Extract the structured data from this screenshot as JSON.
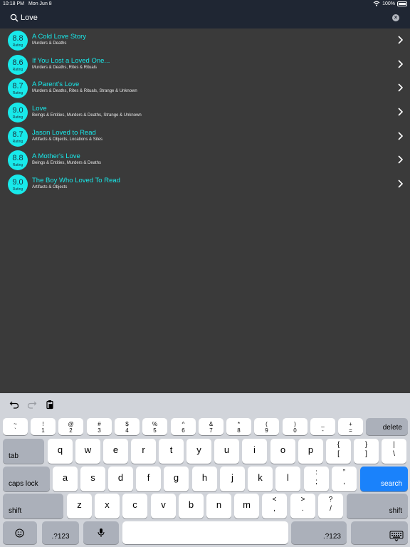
{
  "status": {
    "time": "10:18 PM",
    "date": "Mon Jun 8",
    "battery": "100%"
  },
  "search": {
    "query": "Love"
  },
  "rating_label": "Rating",
  "results": [
    {
      "score": "8.8",
      "title": "A Cold Love Story",
      "categories": "Murders & Deaths"
    },
    {
      "score": "8.6",
      "title": "If You Lost a Loved One...",
      "categories": "Murders & Deaths, Rites & Rituals"
    },
    {
      "score": "8.7",
      "title": "A Parent's Love",
      "categories": "Murders & Deaths, Rites & Rituals, Strange & Unknown"
    },
    {
      "score": "9.0",
      "title": "Love",
      "categories": "Beings & Entities, Murders & Deaths, Strange & Unknown"
    },
    {
      "score": "8.7",
      "title": "Jason Loved to Read",
      "categories": "Artifacts & Objects, Locations & Sites"
    },
    {
      "score": "8.8",
      "title": "A Mother's Love",
      "categories": "Beings & Entities, Murders & Deaths"
    },
    {
      "score": "9.0",
      "title": "The Boy Who Loved To Read",
      "categories": "Artifacts & Objects"
    }
  ],
  "keyboard": {
    "numrow": [
      [
        "~",
        "`"
      ],
      [
        "!",
        "1"
      ],
      [
        "@",
        "2"
      ],
      [
        "#",
        "3"
      ],
      [
        "$",
        "4"
      ],
      [
        "%",
        "5"
      ],
      [
        "^",
        "6"
      ],
      [
        "&",
        "7"
      ],
      [
        "*",
        "8"
      ],
      [
        "(",
        "9"
      ],
      [
        ")",
        "0"
      ],
      [
        "_",
        "-"
      ],
      [
        "+",
        "="
      ]
    ],
    "delete": "delete",
    "tab": "tab",
    "row1": [
      "q",
      "w",
      "e",
      "r",
      "t",
      "y",
      "u",
      "i",
      "o",
      "p"
    ],
    "row1_sym": [
      [
        "{",
        "["
      ],
      [
        "}",
        "]"
      ],
      [
        "|",
        "\\"
      ]
    ],
    "caps": "caps lock",
    "row2": [
      "a",
      "s",
      "d",
      "f",
      "g",
      "h",
      "j",
      "k",
      "l"
    ],
    "row2_sym": [
      [
        ":",
        ";"
      ],
      [
        "”",
        ","
      ]
    ],
    "search": "search",
    "shift": "shift",
    "row3": [
      "z",
      "x",
      "c",
      "v",
      "b",
      "n",
      "m"
    ],
    "row3_sym": [
      [
        "<",
        ","
      ],
      [
        ">",
        "."
      ],
      [
        "?",
        "/"
      ]
    ],
    "numkey": ".?123"
  }
}
